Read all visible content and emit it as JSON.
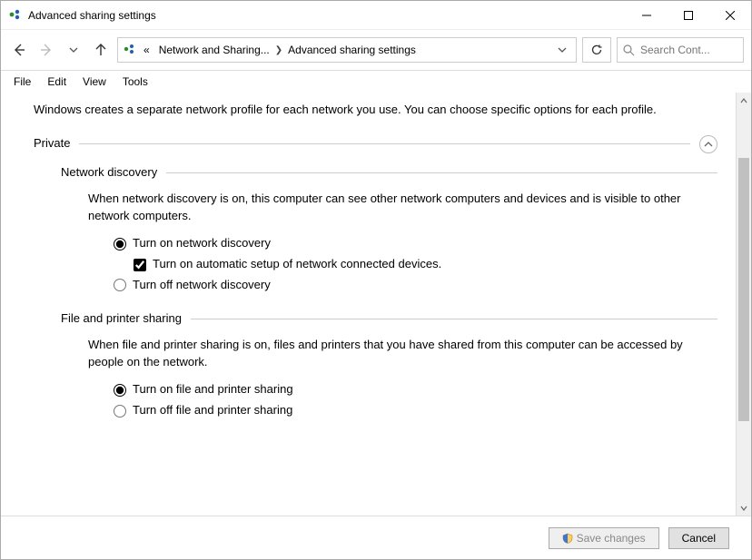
{
  "window": {
    "title": "Advanced sharing settings"
  },
  "breadcrumb": {
    "prefix": "«",
    "seg1": "Network and Sharing...",
    "seg2": "Advanced sharing settings"
  },
  "search": {
    "placeholder": "Search Cont..."
  },
  "menu": {
    "file": "File",
    "edit": "Edit",
    "view": "View",
    "tools": "Tools"
  },
  "intro": "Windows creates a separate network profile for each network you use. You can choose specific options for each profile.",
  "private": {
    "label": "Private",
    "network_discovery": {
      "heading": "Network discovery",
      "desc": "When network discovery is on, this computer can see other network computers and devices and is visible to other network computers.",
      "opt_on": "Turn on network discovery",
      "opt_auto": "Turn on automatic setup of network connected devices.",
      "opt_off": "Turn off network discovery"
    },
    "file_printer": {
      "heading": "File and printer sharing",
      "desc": "When file and printer sharing is on, files and printers that you have shared from this computer can be accessed by people on the network.",
      "opt_on": "Turn on file and printer sharing",
      "opt_off": "Turn off file and printer sharing"
    }
  },
  "footer": {
    "save": "Save changes",
    "cancel": "Cancel"
  }
}
